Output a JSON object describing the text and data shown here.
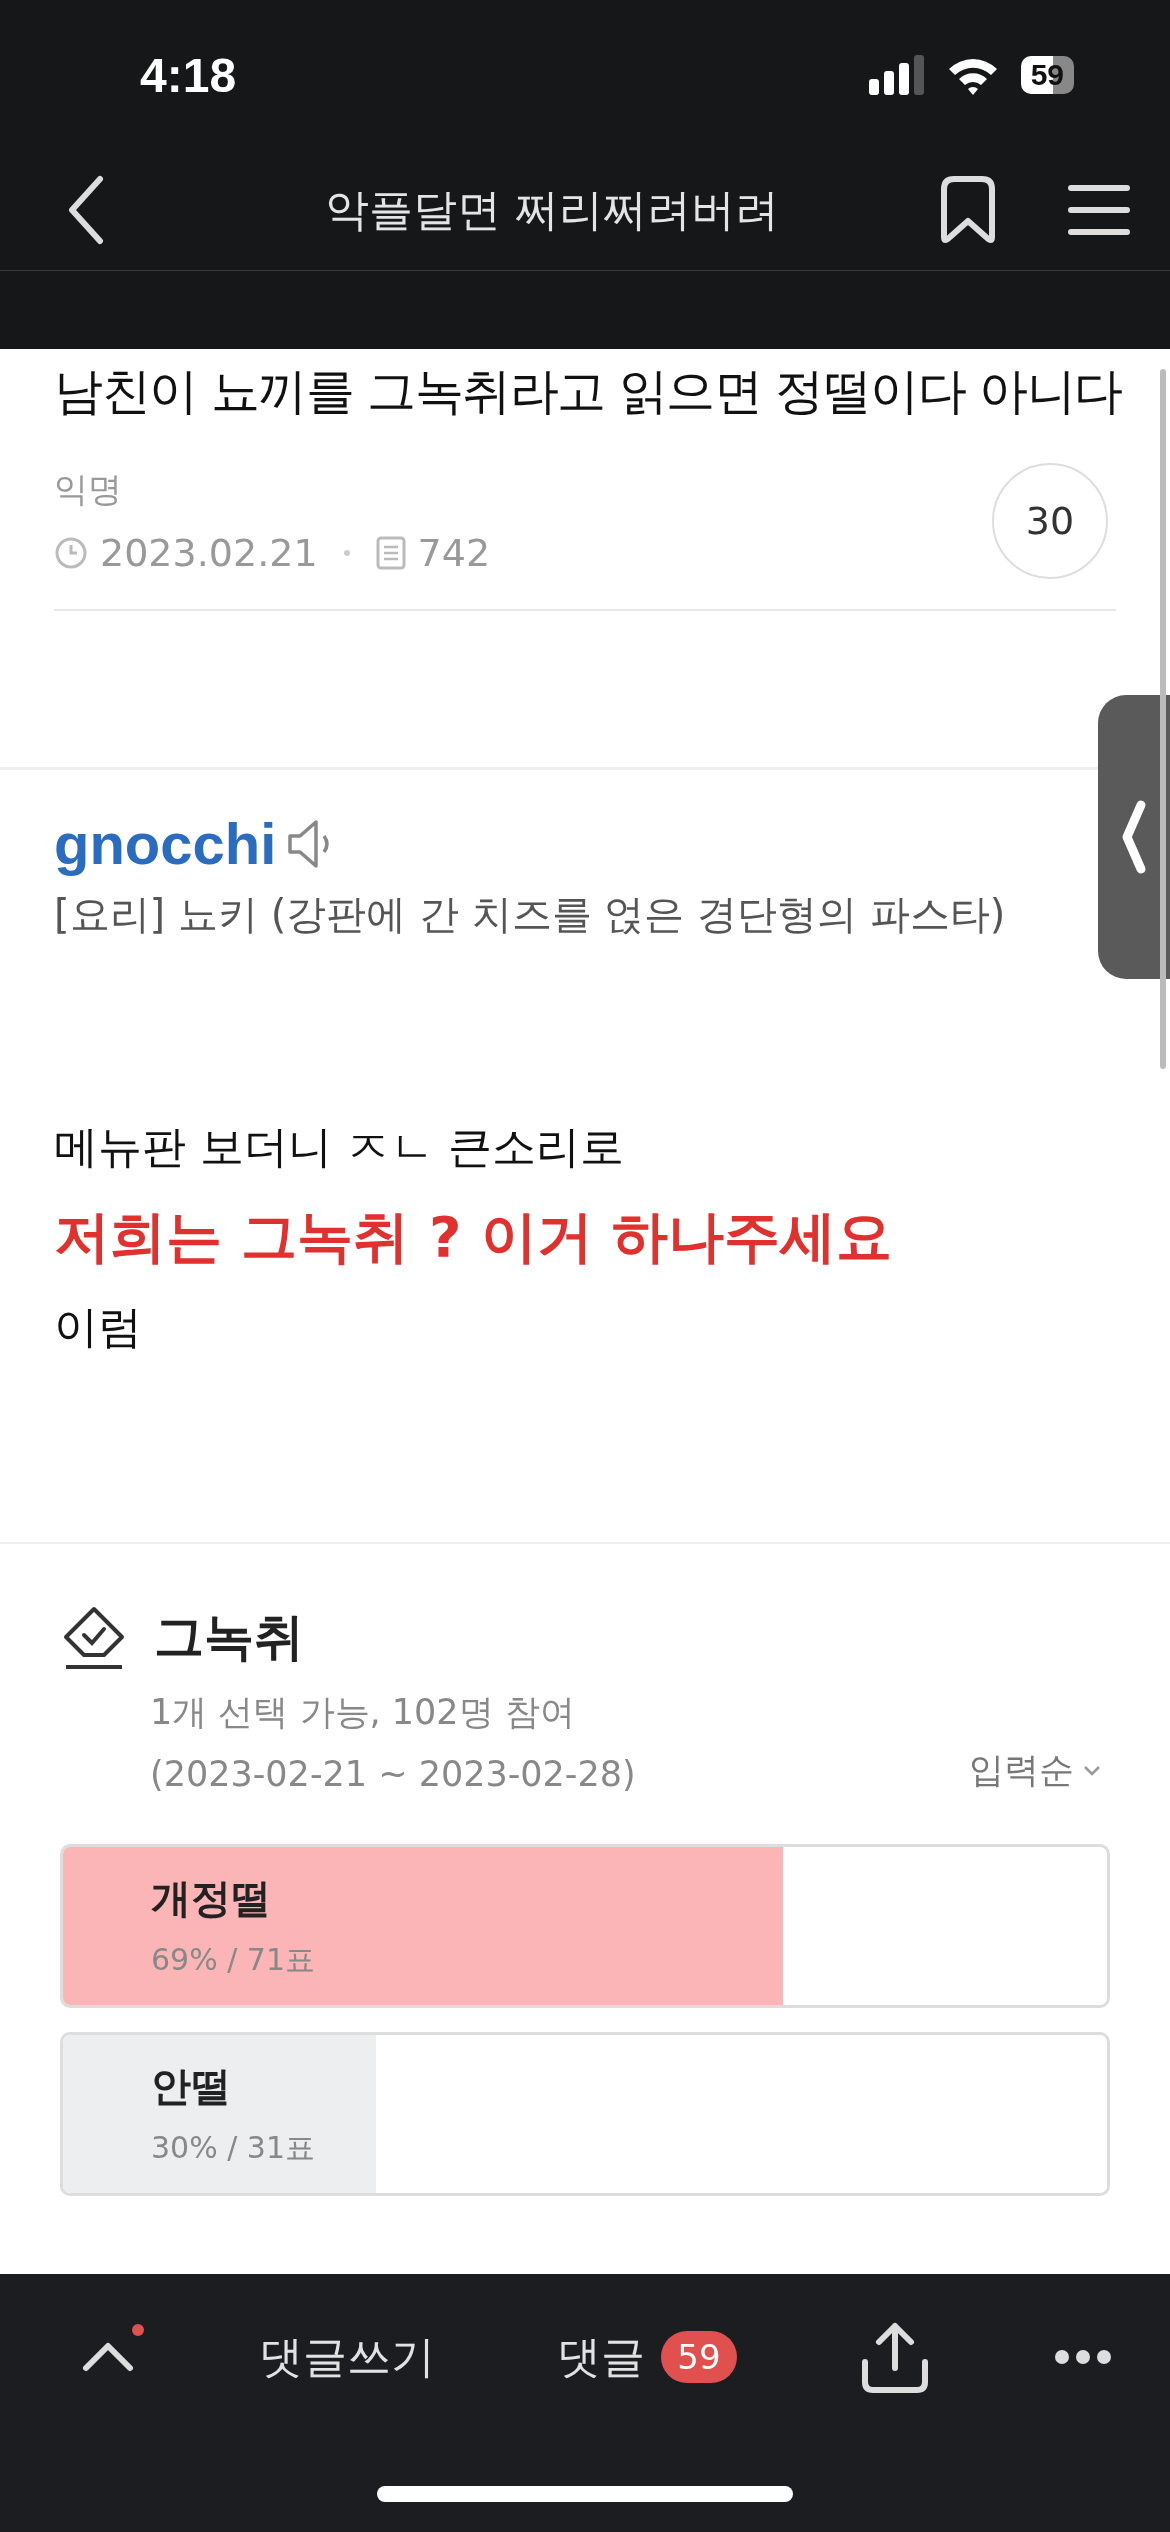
{
  "status_bar": {
    "time": "4:18",
    "battery": "59"
  },
  "nav": {
    "title": "악플달면 쩌리쩌려버려"
  },
  "post": {
    "title": "남친이 뇨끼를 그녹취라고 읽으면 정떨이다 아니다",
    "author": "익명",
    "date": "2023.02.21",
    "views": "742",
    "count": "30"
  },
  "dictionary": {
    "word": "gnocchi",
    "definition": "[요리] 뇨키 (강판에 간 치즈를 얹은 경단형의 파스타)"
  },
  "paragraphs": [
    {
      "kind": "plain",
      "text": "메뉴판 보더니 ㅈㄴ 큰소리로"
    },
    {
      "kind": "emphasis",
      "text": "저희는 그녹취 ? 이거 하나주세요"
    },
    {
      "kind": "plain",
      "text": "이럼"
    }
  ],
  "poll": {
    "title": "그녹취",
    "info": "1개 선택 가능, 102명 참여",
    "period": "(2023-02-21 ~ 2023-02-28)",
    "sort": "입력순",
    "options": [
      {
        "label": "개정떨",
        "result": "69% / 71표",
        "level": 0.69,
        "leading": true
      },
      {
        "label": "안떨",
        "result": "30% / 31표",
        "level": 0.3,
        "leading": false
      }
    ]
  },
  "bottom_bar": {
    "up_notification": true,
    "write_label": "댓글쓰기",
    "comments_label": "댓글",
    "comments_count": "59"
  }
}
